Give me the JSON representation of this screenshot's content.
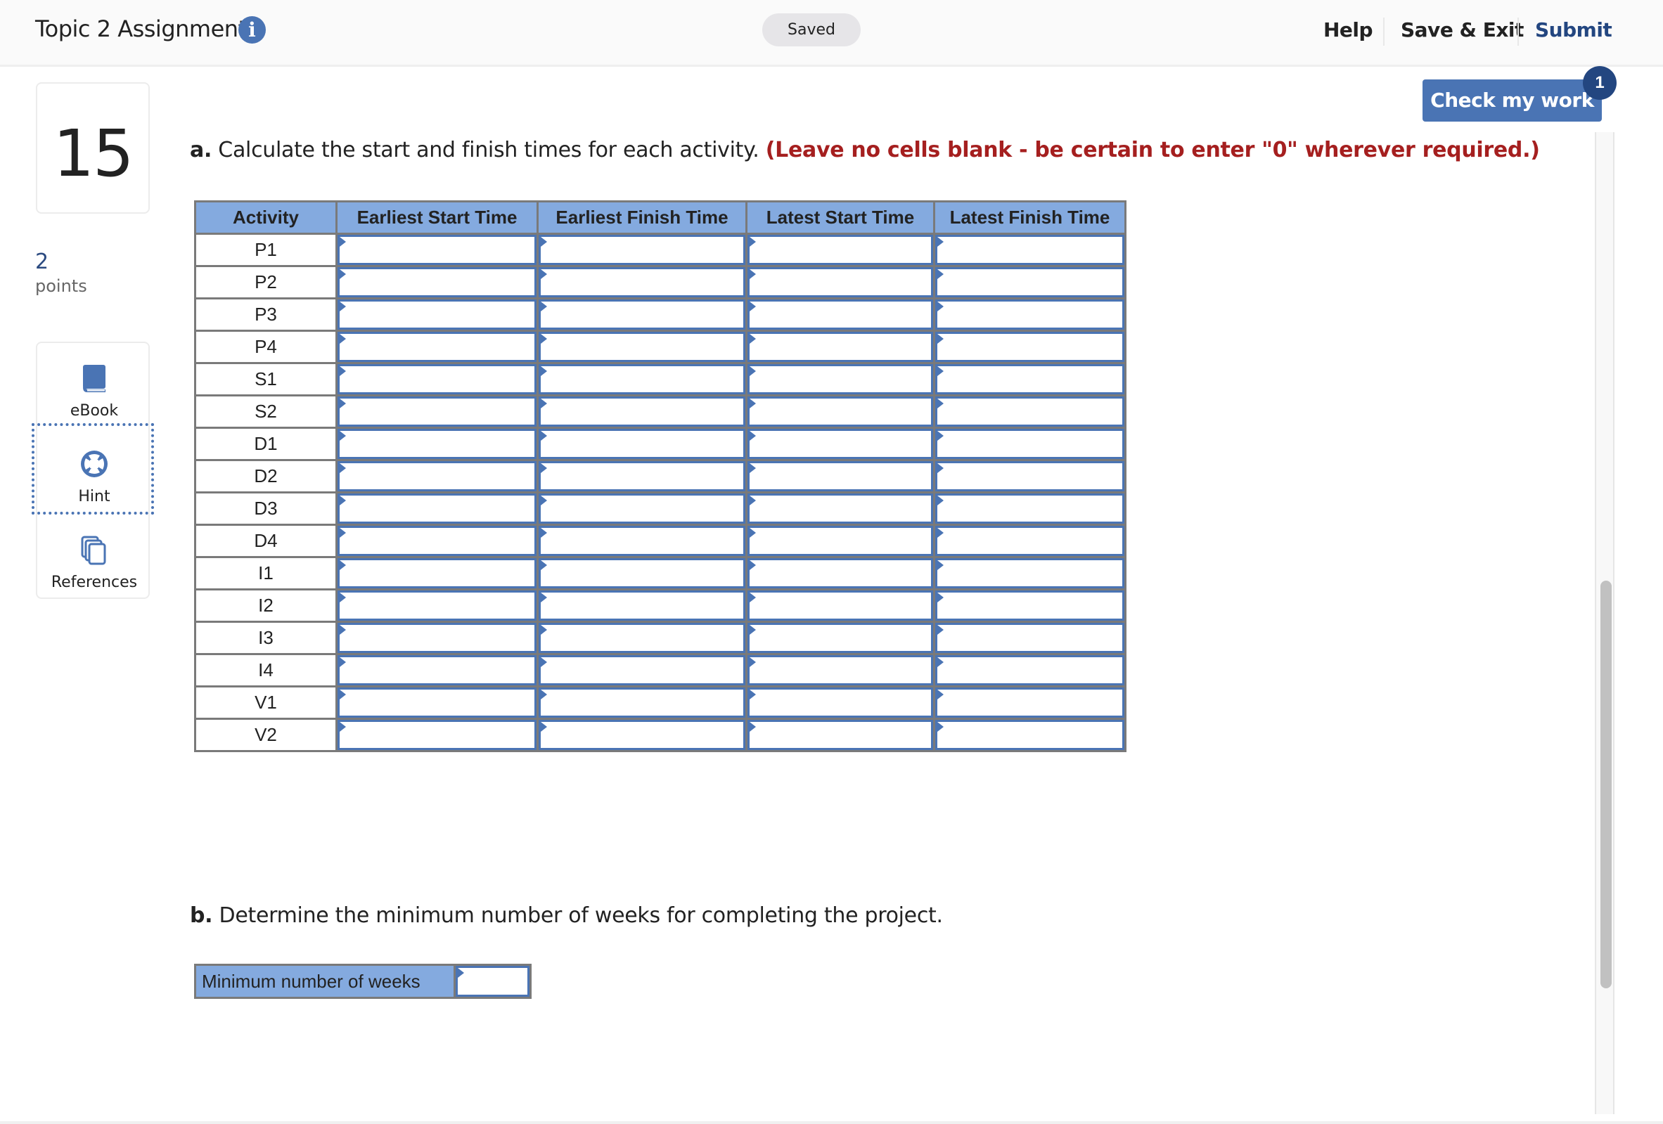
{
  "header": {
    "title": "Topic 2 Assignment",
    "info_icon": "info-icon",
    "status": "Saved",
    "links": {
      "help": "Help",
      "save_exit": "Save & Exit",
      "submit": "Submit"
    }
  },
  "colors": {
    "accent": "#4a74b4",
    "submit_link": "#234680",
    "warning": "#a51f1f",
    "table_header": "#84aadf"
  },
  "question": {
    "number": "15",
    "points_value": "2",
    "points_label": "points"
  },
  "tools": [
    {
      "label": "eBook",
      "icon": "book-icon"
    },
    {
      "label": "Hint",
      "icon": "lifebuoy-icon"
    },
    {
      "label": "References",
      "icon": "documents-icon"
    }
  ],
  "check_work": {
    "label": "Check my work",
    "badge": "1"
  },
  "part_a": {
    "prefix": "a.",
    "text": "Calculate the start and finish times for each activity.",
    "warning": "(Leave no cells blank - be certain to enter \"0\" wherever required.)"
  },
  "table": {
    "headers": [
      "Activity",
      "Earliest Start Time",
      "Earliest Finish Time",
      "Latest Start Time",
      "Latest Finish Time"
    ],
    "rows": [
      {
        "activity": "P1",
        "values": [
          "",
          "",
          "",
          ""
        ]
      },
      {
        "activity": "P2",
        "values": [
          "",
          "",
          "",
          ""
        ]
      },
      {
        "activity": "P3",
        "values": [
          "",
          "",
          "",
          ""
        ]
      },
      {
        "activity": "P4",
        "values": [
          "",
          "",
          "",
          ""
        ]
      },
      {
        "activity": "S1",
        "values": [
          "",
          "",
          "",
          ""
        ]
      },
      {
        "activity": "S2",
        "values": [
          "",
          "",
          "",
          ""
        ]
      },
      {
        "activity": "D1",
        "values": [
          "",
          "",
          "",
          ""
        ]
      },
      {
        "activity": "D2",
        "values": [
          "",
          "",
          "",
          ""
        ]
      },
      {
        "activity": "D3",
        "values": [
          "",
          "",
          "",
          ""
        ]
      },
      {
        "activity": "D4",
        "values": [
          "",
          "",
          "",
          ""
        ]
      },
      {
        "activity": "I1",
        "values": [
          "",
          "",
          "",
          ""
        ]
      },
      {
        "activity": "I2",
        "values": [
          "",
          "",
          "",
          ""
        ]
      },
      {
        "activity": "I3",
        "values": [
          "",
          "",
          "",
          ""
        ]
      },
      {
        "activity": "I4",
        "values": [
          "",
          "",
          "",
          ""
        ]
      },
      {
        "activity": "V1",
        "values": [
          "",
          "",
          "",
          ""
        ]
      },
      {
        "activity": "V2",
        "values": [
          "",
          "",
          "",
          ""
        ]
      }
    ]
  },
  "part_b": {
    "prefix": "b.",
    "text": "Determine the minimum number of weeks for completing the project.",
    "field_label": "Minimum number of weeks",
    "field_value": ""
  }
}
